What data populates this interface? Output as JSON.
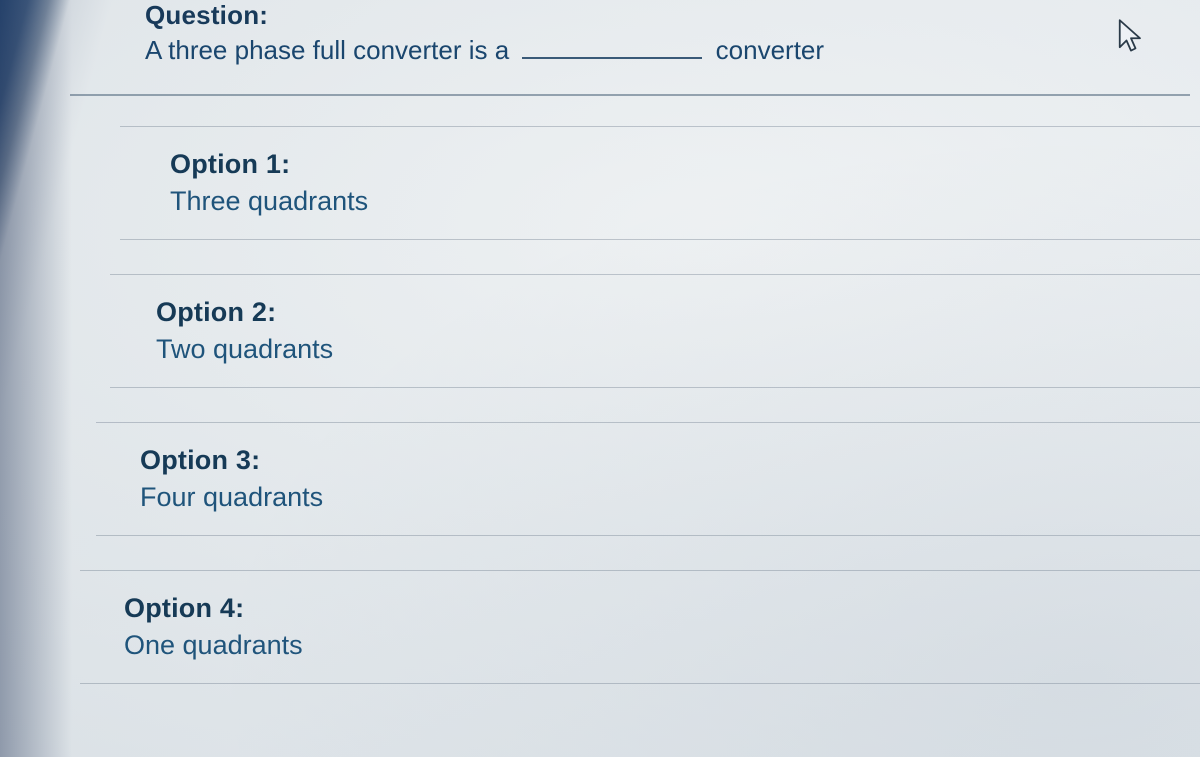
{
  "question": {
    "label": "Question:",
    "text_before": "A three phase full converter is a ",
    "text_after": "converter"
  },
  "options": [
    {
      "label": "Option 1:",
      "text": "Three quadrants"
    },
    {
      "label": "Option 2:",
      "text": "Two quadrants"
    },
    {
      "label": "Option 3:",
      "text": "Four quadrants"
    },
    {
      "label": "Option 4:",
      "text": "One quadrants"
    }
  ]
}
